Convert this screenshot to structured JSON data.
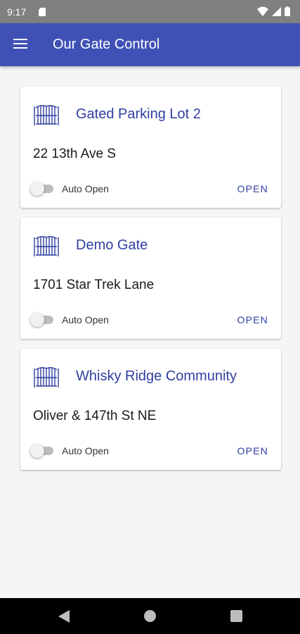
{
  "status_bar": {
    "time": "9:17",
    "icons": [
      "sd-card-icon",
      "wifi-icon",
      "signal-icon",
      "battery-icon"
    ]
  },
  "app_bar": {
    "title": "Our Gate Control",
    "menu_icon": "menu-icon"
  },
  "colors": {
    "primary": "#3f51b5",
    "accent_text": "#2f3ea0",
    "status_bar": "#808080",
    "background": "#f5f5f5"
  },
  "gates": [
    {
      "name": "Gated Parking Lot 2",
      "address": "22 13th Ave S",
      "auto_open_label": "Auto Open",
      "auto_open": false,
      "action_label": "OPEN",
      "icon": "gate-icon"
    },
    {
      "name": "Demo Gate",
      "address": "1701 Star Trek Lane",
      "auto_open_label": "Auto Open",
      "auto_open": false,
      "action_label": "OPEN",
      "icon": "gate-icon"
    },
    {
      "name": "Whisky Ridge Community",
      "address": "Oliver & 147th St NE",
      "auto_open_label": "Auto Open",
      "auto_open": false,
      "action_label": "OPEN",
      "icon": "gate-icon"
    }
  ],
  "nav_bar": {
    "icons": [
      "back-icon",
      "home-icon",
      "recents-icon"
    ]
  }
}
